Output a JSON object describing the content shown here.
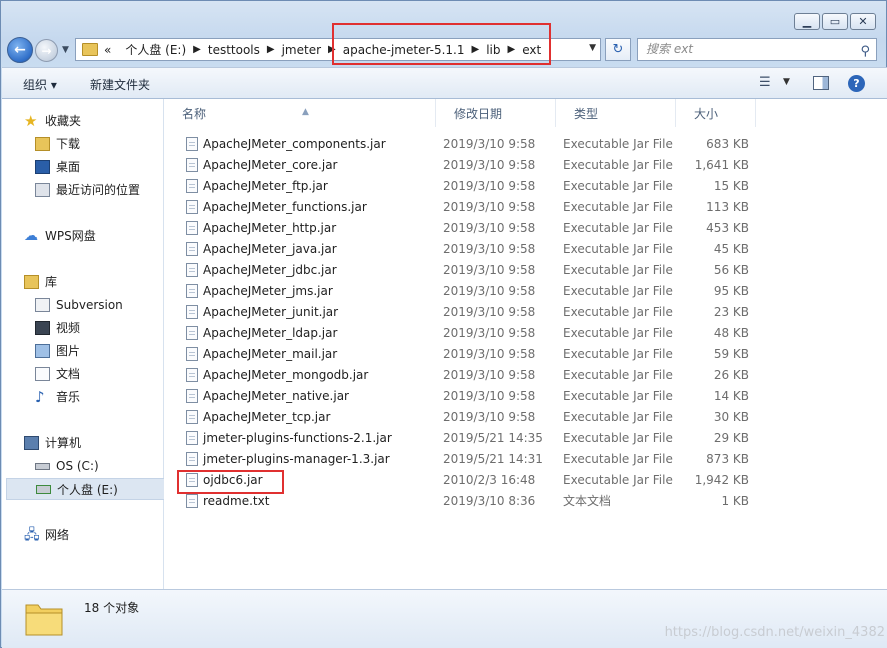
{
  "address": {
    "prefix": "«",
    "crumbs": [
      "个人盘 (E:)",
      "testtools",
      "jmeter",
      "apache-jmeter-5.1.1",
      "lib",
      "ext"
    ]
  },
  "search": {
    "placeholder": "搜索 ext"
  },
  "toolbar": {
    "organize": "组织 ▾",
    "new_folder": "新建文件夹"
  },
  "nav": {
    "favorites": "收藏夹",
    "downloads": "下载",
    "desktop": "桌面",
    "recent": "最近访问的位置",
    "wps": "WPS网盘",
    "libraries": "库",
    "subversion": "Subversion",
    "videos": "视频",
    "pictures": "图片",
    "documents": "文档",
    "music": "音乐",
    "computer": "计算机",
    "os_drive": "OS (C:)",
    "personal_drive": "个人盘 (E:)",
    "network": "网络"
  },
  "columns": {
    "name": "名称",
    "date": "修改日期",
    "type": "类型",
    "size": "大小"
  },
  "files": [
    {
      "name": "ApacheJMeter_components.jar",
      "date": "2019/3/10 9:58",
      "type": "Executable Jar File",
      "size": "683 KB"
    },
    {
      "name": "ApacheJMeter_core.jar",
      "date": "2019/3/10 9:58",
      "type": "Executable Jar File",
      "size": "1,641 KB"
    },
    {
      "name": "ApacheJMeter_ftp.jar",
      "date": "2019/3/10 9:58",
      "type": "Executable Jar File",
      "size": "15 KB"
    },
    {
      "name": "ApacheJMeter_functions.jar",
      "date": "2019/3/10 9:58",
      "type": "Executable Jar File",
      "size": "113 KB"
    },
    {
      "name": "ApacheJMeter_http.jar",
      "date": "2019/3/10 9:58",
      "type": "Executable Jar File",
      "size": "453 KB"
    },
    {
      "name": "ApacheJMeter_java.jar",
      "date": "2019/3/10 9:58",
      "type": "Executable Jar File",
      "size": "45 KB"
    },
    {
      "name": "ApacheJMeter_jdbc.jar",
      "date": "2019/3/10 9:58",
      "type": "Executable Jar File",
      "size": "56 KB"
    },
    {
      "name": "ApacheJMeter_jms.jar",
      "date": "2019/3/10 9:58",
      "type": "Executable Jar File",
      "size": "95 KB"
    },
    {
      "name": "ApacheJMeter_junit.jar",
      "date": "2019/3/10 9:58",
      "type": "Executable Jar File",
      "size": "23 KB"
    },
    {
      "name": "ApacheJMeter_ldap.jar",
      "date": "2019/3/10 9:58",
      "type": "Executable Jar File",
      "size": "48 KB"
    },
    {
      "name": "ApacheJMeter_mail.jar",
      "date": "2019/3/10 9:58",
      "type": "Executable Jar File",
      "size": "59 KB"
    },
    {
      "name": "ApacheJMeter_mongodb.jar",
      "date": "2019/3/10 9:58",
      "type": "Executable Jar File",
      "size": "26 KB"
    },
    {
      "name": "ApacheJMeter_native.jar",
      "date": "2019/3/10 9:58",
      "type": "Executable Jar File",
      "size": "14 KB"
    },
    {
      "name": "ApacheJMeter_tcp.jar",
      "date": "2019/3/10 9:58",
      "type": "Executable Jar File",
      "size": "30 KB"
    },
    {
      "name": "jmeter-plugins-functions-2.1.jar",
      "date": "2019/5/21 14:35",
      "type": "Executable Jar File",
      "size": "29 KB"
    },
    {
      "name": "jmeter-plugins-manager-1.3.jar",
      "date": "2019/5/21 14:31",
      "type": "Executable Jar File",
      "size": "873 KB"
    },
    {
      "name": "ojdbc6.jar",
      "date": "2010/2/3 16:48",
      "type": "Executable Jar File",
      "size": "1,942 KB"
    },
    {
      "name": "readme.txt",
      "date": "2019/3/10 8:36",
      "type": "文本文档",
      "size": "1 KB"
    }
  ],
  "status": {
    "count": "18 个对象"
  },
  "watermark": "https://blog.csdn.net/weixin_4382",
  "colors": {
    "highlight": "#e03030",
    "selected": "#dce6f2"
  }
}
